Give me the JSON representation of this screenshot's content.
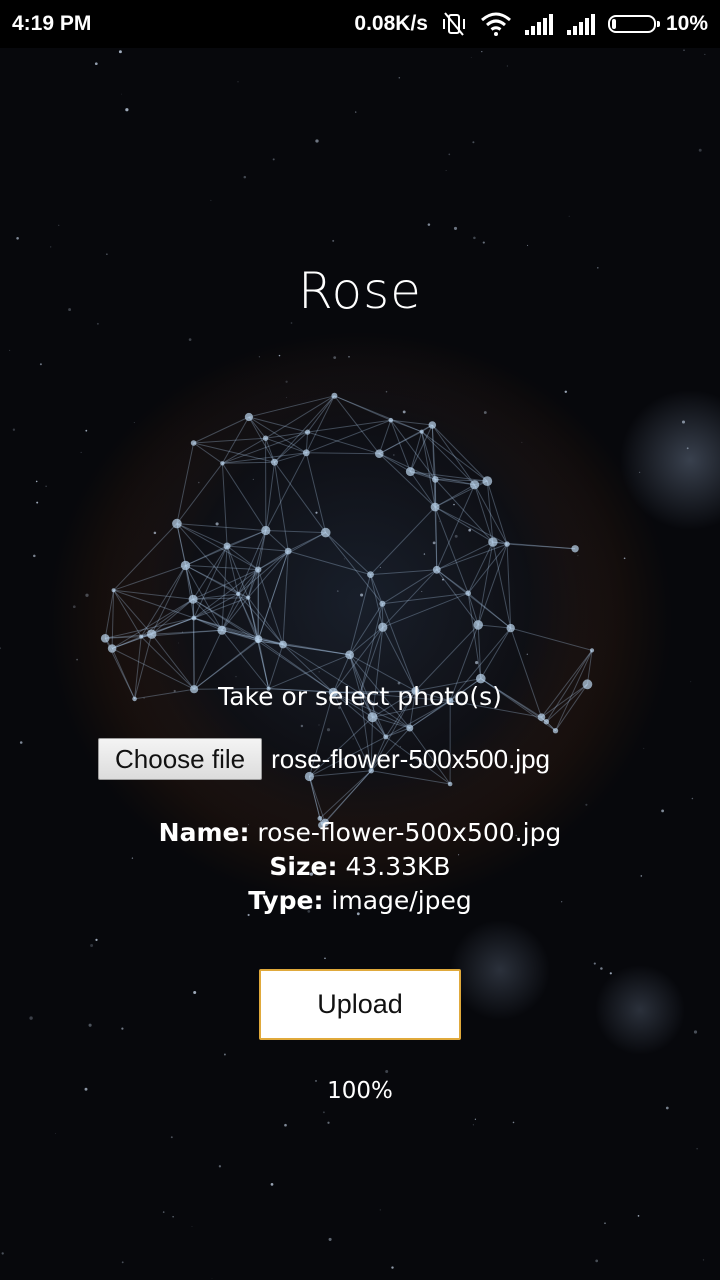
{
  "status_bar": {
    "time": "4:19 PM",
    "network_speed": "0.08K/s",
    "battery_percent": "10%",
    "battery_level": 0.1,
    "icons": [
      "vibrate-off-icon",
      "wifi-icon",
      "signal-icon",
      "signal-icon",
      "battery-icon"
    ]
  },
  "page": {
    "title": "Rose",
    "prompt": "Take or select photo(s)",
    "file_input": {
      "button_label": "Choose file",
      "selected_file": "rose-flower-500x500.jpg"
    },
    "file_info": {
      "name_label": "Name:",
      "name_value": "rose-flower-500x500.jpg",
      "size_label": "Size:",
      "size_value": "43.33KB",
      "type_label": "Type:",
      "type_value": "image/jpeg"
    },
    "upload_label": "Upload",
    "progress_text": "100%"
  },
  "colors": {
    "upload_border": "#e0a93b",
    "background": "#07080c"
  }
}
